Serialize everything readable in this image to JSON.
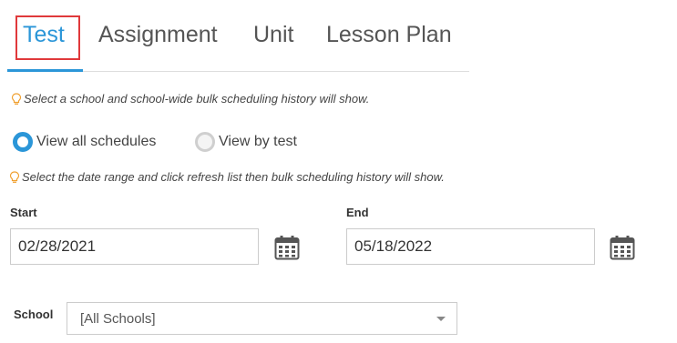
{
  "tabs": [
    {
      "label": "Test",
      "active": true
    },
    {
      "label": "Assignment",
      "active": false
    },
    {
      "label": "Unit",
      "active": false
    },
    {
      "label": "Lesson Plan",
      "active": false
    }
  ],
  "hints": {
    "school": "Select a school and school-wide bulk scheduling history will show.",
    "date_range": "Select the date range and click refresh list then bulk scheduling history will show."
  },
  "radios": {
    "view_all": {
      "label": "View all schedules",
      "selected": true
    },
    "view_by_test": {
      "label": "View by test",
      "selected": false
    }
  },
  "dates": {
    "start_label": "Start",
    "start_value": "02/28/2021",
    "end_label": "End",
    "end_value": "05/18/2022"
  },
  "school": {
    "label": "School",
    "selected": "[All Schools]"
  },
  "icons": {
    "hint": "lightbulb-icon",
    "calendar": "calendar-icon",
    "select": "caret-down-icon"
  },
  "colors": {
    "accent": "#2b96d8",
    "highlight_box": "#e0393b",
    "hint_bulb": "#f0a030"
  }
}
